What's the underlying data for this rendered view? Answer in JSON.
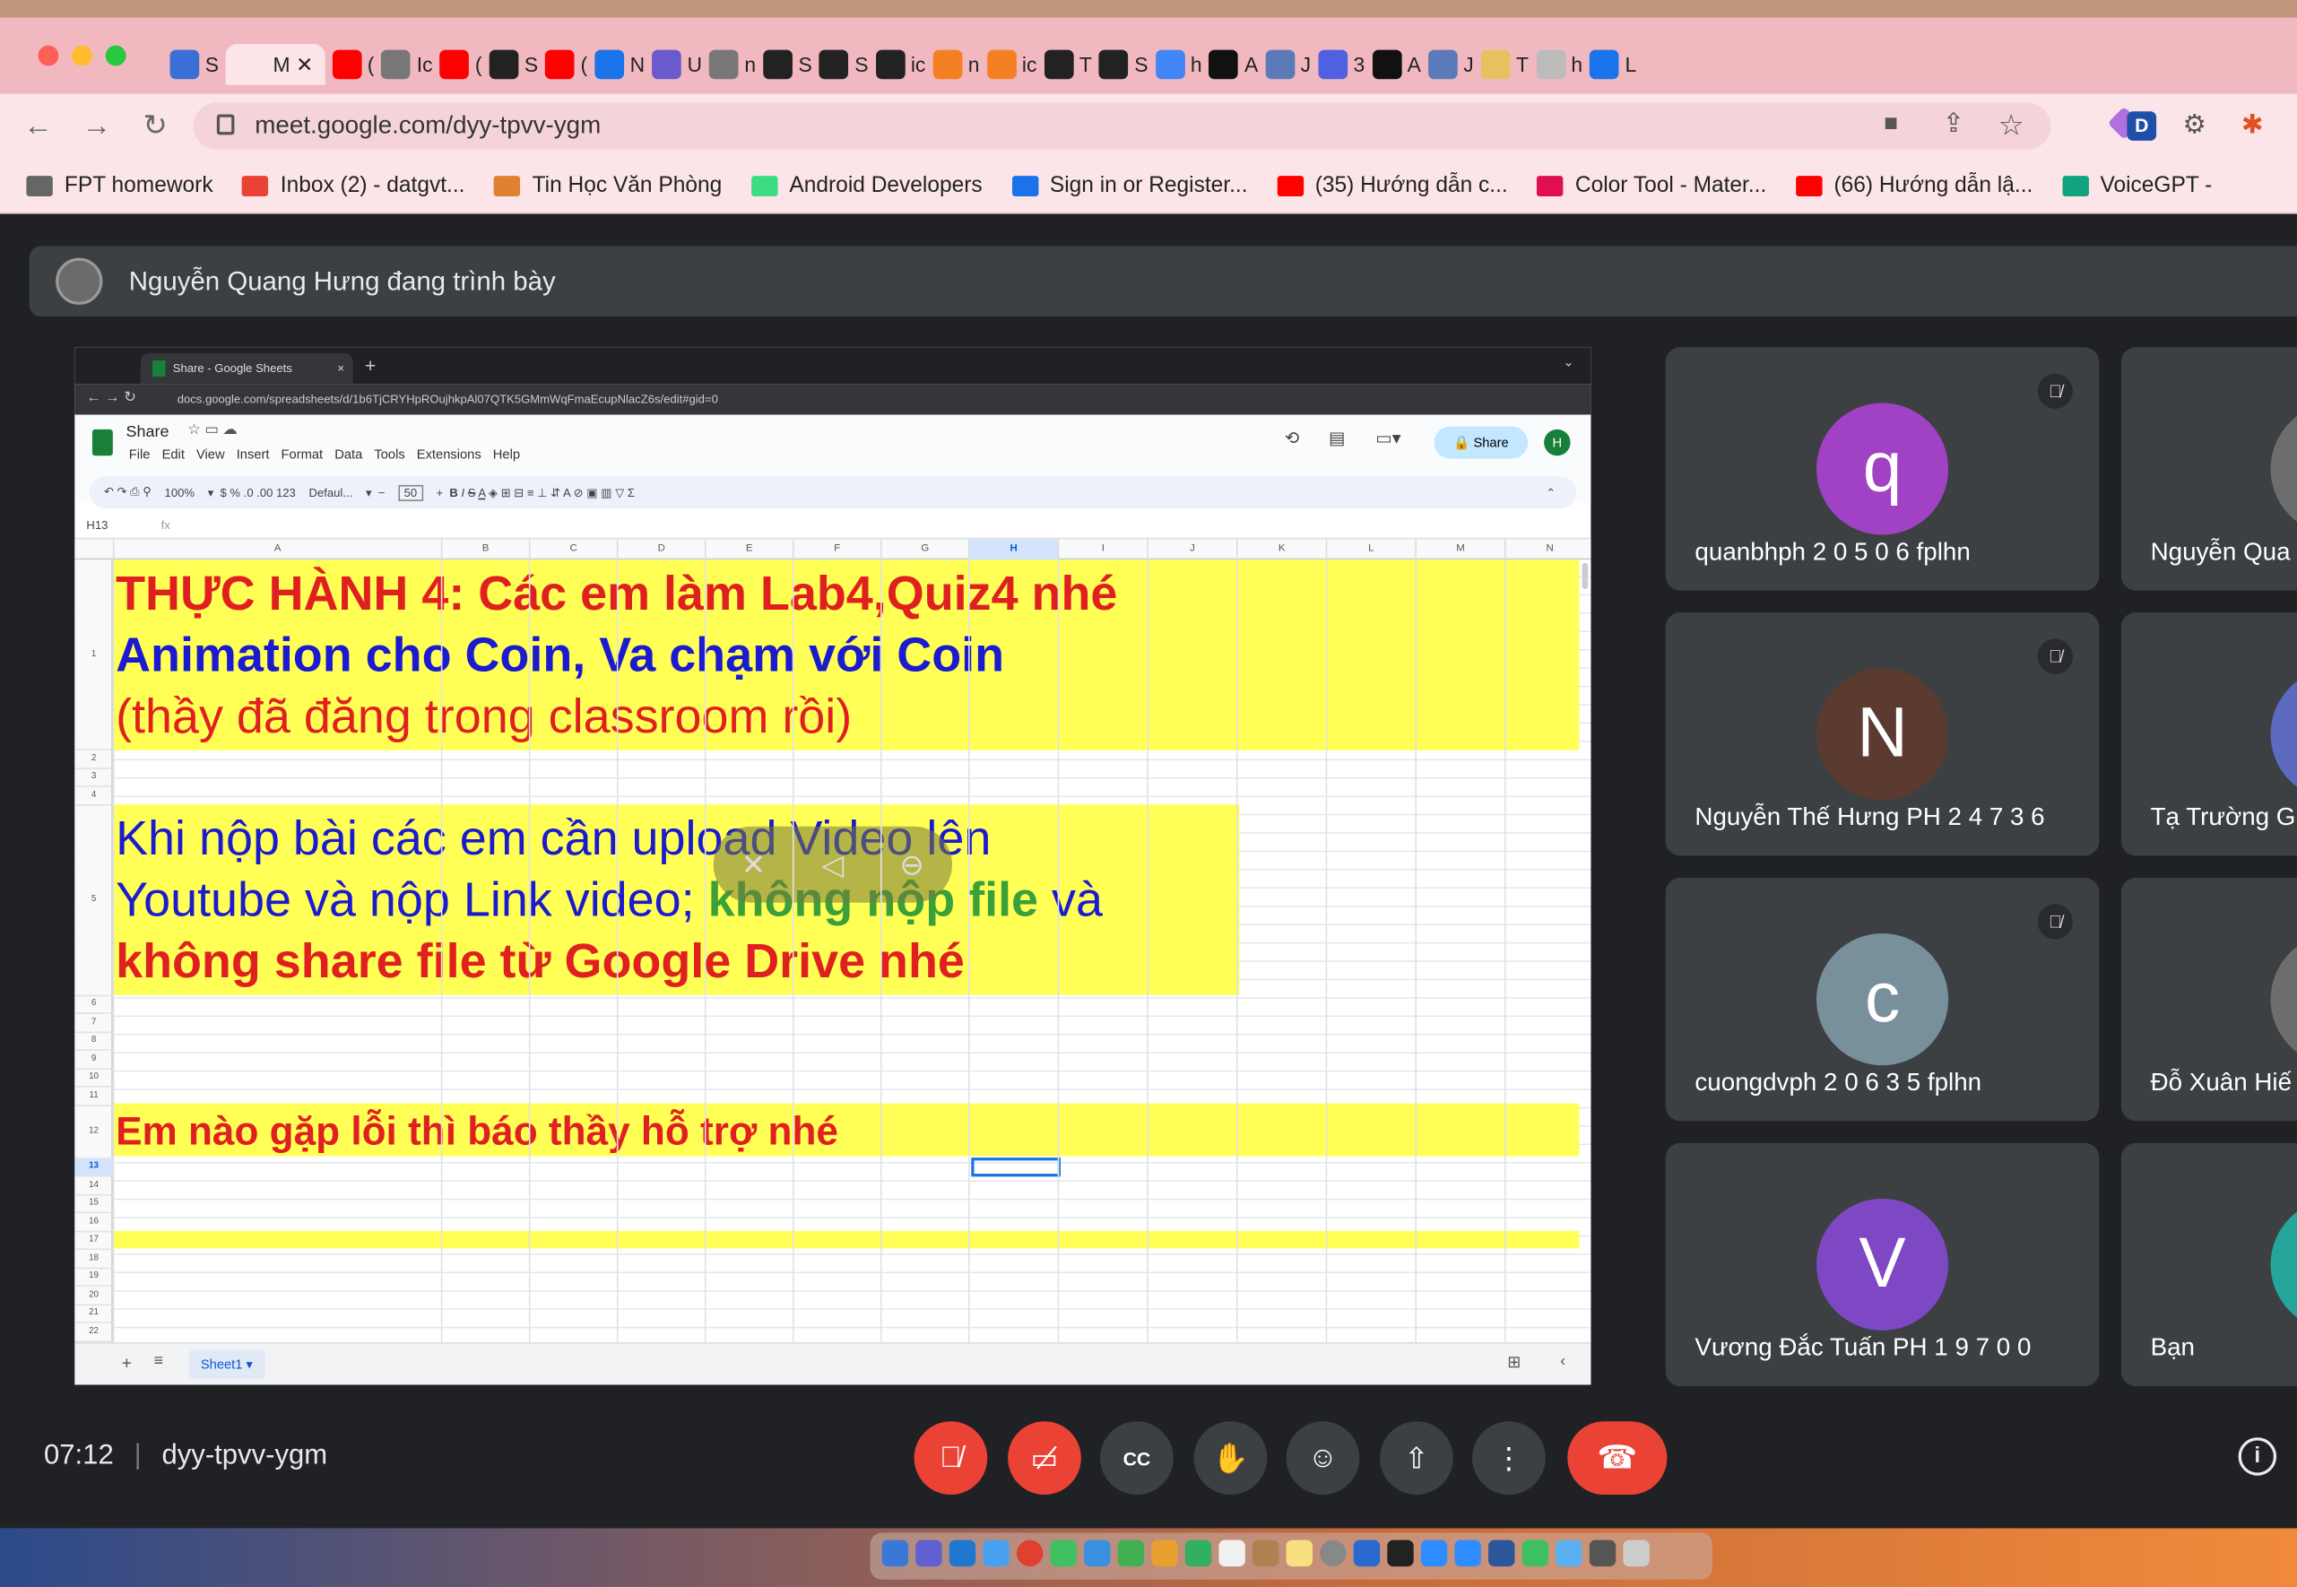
{
  "browser": {
    "tabs": [
      {
        "label": "S",
        "color": "#3b6fd8"
      },
      {
        "label": "M",
        "color": "#fbe5e9",
        "active": true
      },
      {
        "label": "(",
        "color": "#ff0000"
      },
      {
        "label": "Ic",
        "color": "#777777"
      },
      {
        "label": "(",
        "color": "#ff0000"
      },
      {
        "label": "S",
        "color": "#222222"
      },
      {
        "label": "(",
        "color": "#ff0000"
      },
      {
        "label": "N",
        "color": "#1a73e8"
      },
      {
        "label": "U",
        "color": "#6a5acd"
      },
      {
        "label": "n",
        "color": "#777777"
      },
      {
        "label": "S",
        "color": "#222222"
      },
      {
        "label": "S",
        "color": "#222222"
      },
      {
        "label": "ic",
        "color": "#222222"
      },
      {
        "label": "n",
        "color": "#f48024"
      },
      {
        "label": "ic",
        "color": "#f48024"
      },
      {
        "label": "T",
        "color": "#222222"
      },
      {
        "label": "S",
        "color": "#222222"
      },
      {
        "label": "h",
        "color": "#4285f4"
      },
      {
        "label": "A",
        "color": "#111111"
      },
      {
        "label": "J",
        "color": "#5c7ab8"
      },
      {
        "label": "3",
        "color": "#5060e0"
      },
      {
        "label": "A",
        "color": "#111111"
      },
      {
        "label": "J",
        "color": "#5c7ab8"
      },
      {
        "label": "T",
        "color": "#e8c060"
      },
      {
        "label": "h",
        "color": "#bbbbbb"
      },
      {
        "label": "L",
        "color": "#1a73e8"
      }
    ],
    "url": "meet.google.com/dyy-tpvv-ygm",
    "bookmarks": [
      {
        "label": "FPT homework",
        "color": "#666666"
      },
      {
        "label": "Inbox (2) - datgvt...",
        "color": "#ea4335"
      },
      {
        "label": "Tin Học Văn Phòng",
        "color": "#e08030"
      },
      {
        "label": "Android Developers",
        "color": "#3ddc84"
      },
      {
        "label": "Sign in or Register...",
        "color": "#1a73e8"
      },
      {
        "label": "(35) Hướng dẫn c...",
        "color": "#ff0000"
      },
      {
        "label": "Color Tool - Mater...",
        "color": "#e01050"
      },
      {
        "label": "(66) Hướng dẫn lậ...",
        "color": "#ff0000"
      },
      {
        "label": "VoiceGPT -",
        "color": "#10a37f"
      }
    ]
  },
  "meet": {
    "presenter_text": "Nguyễn Quang Hưng đang trình bày",
    "time": "07:12",
    "meeting_code": "dyy-tpvv-ygm",
    "participants": [
      {
        "initial": "q",
        "name": "quanbhph 2 0 5 0 6 fplhn",
        "color": "#a142c4",
        "muted": true
      },
      {
        "initial": "N",
        "name": "Nguyễn Thế Hưng PH 2 4 7 3 6",
        "color": "#5b3a30",
        "muted": true
      },
      {
        "initial": "c",
        "name": "cuongdvph 2 0 6 3 5 fplhn",
        "color": "#78909c",
        "muted": true
      },
      {
        "initial": "V",
        "name": "Vương Đắc Tuấn PH 1 9 7 0 0",
        "color": "#7e47c4",
        "muted": false
      }
    ],
    "side_participants": [
      "Nguyễn Qua",
      "Tạ Trường G",
      "Đỗ Xuân Hiế",
      "Bạn"
    ]
  },
  "shared_screen": {
    "tab_title": "Share - Google Sheets",
    "url": "docs.google.com/spreadsheets/d/1b6TjCRYHpROujhkpAl07QTK5GMmWqFmaEcupNlacZ6s/edit#gid=0",
    "doc_title": "Share",
    "menu": [
      "File",
      "Edit",
      "View",
      "Insert",
      "Format",
      "Data",
      "Tools",
      "Extensions",
      "Help"
    ],
    "zoom": "100%",
    "font": "Defaul...",
    "font_size": "50",
    "share_label": "Share",
    "cell_ref": "H13",
    "columns": [
      "A",
      "B",
      "C",
      "D",
      "E",
      "F",
      "G",
      "H",
      "I",
      "J",
      "K",
      "L",
      "M",
      "N"
    ],
    "rows": [
      "1",
      "2",
      "3",
      "4",
      "5",
      "6",
      "7",
      "8",
      "9",
      "10",
      "11",
      "12",
      "13",
      "14",
      "15",
      "16",
      "17",
      "18",
      "19",
      "20",
      "21",
      "22"
    ],
    "sheet_name": "Sheet1",
    "cell1": {
      "line1": "THỰC HÀNH 4: Các em làm Lab4,Quiz4 nhé",
      "line2": "Animation cho Coin, Va chạm với Coin",
      "line3": "(thầy đã đăng trong classroom rồi)"
    },
    "cell5": {
      "line1": "Khi nộp bài các em cần upload Video lên",
      "line2a": "Youtube và nộp Link video; ",
      "line2b": "không nộp file",
      "line2c": " và",
      "line3": "không share file từ Google Drive nhé"
    },
    "cell12": "Em nào gặp lỗi thì báo thầy hỗ trợ nhé"
  }
}
